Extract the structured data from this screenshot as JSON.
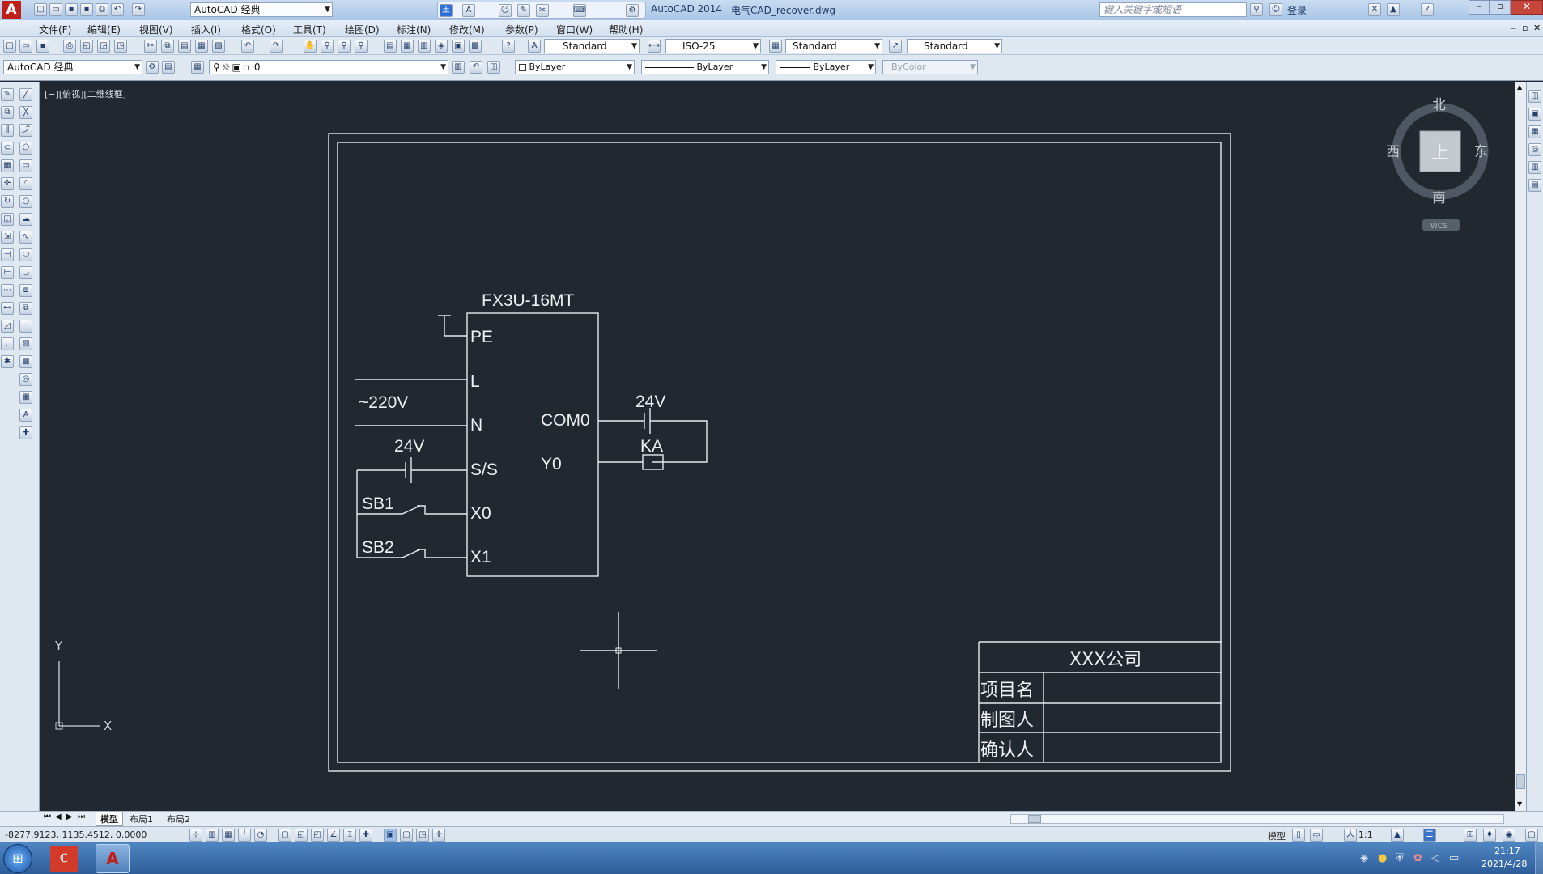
{
  "titlebar": {
    "workspace": "AutoCAD 经典",
    "app_name": "AutoCAD 2014",
    "file_name": "电气CAD_recover.dwg",
    "search_placeholder": "键入关键字或短语",
    "login": "登录"
  },
  "menu": [
    "文件(F)",
    "编辑(E)",
    "视图(V)",
    "插入(I)",
    "格式(O)",
    "工具(T)",
    "绘图(D)",
    "标注(N)",
    "修改(M)",
    "参数(P)",
    "窗口(W)",
    "帮助(H)"
  ],
  "styles": {
    "text_style": "Standard",
    "dim_style": "ISO-25",
    "table_style": "Standard",
    "mleader_style": "Standard"
  },
  "layers": {
    "workspace": "AutoCAD 经典",
    "current_layer": "0",
    "color": "ByLayer",
    "linetype": "ByLayer",
    "lineweight": "ByLayer",
    "plot_style": "ByColor"
  },
  "viewport_label": "[−][俯视][二维线框]",
  "viewcube": {
    "north": "北",
    "south": "南",
    "east": "东",
    "west": "西",
    "top": "上",
    "wcs": "WCS"
  },
  "ucs": {
    "x": "X",
    "y": "Y"
  },
  "drawing": {
    "plc_model": "FX3U-16MT",
    "left_terminals": [
      "PE",
      "L",
      "N",
      "S/S",
      "X0",
      "X1"
    ],
    "right_terminals": [
      "COM0",
      "Y0"
    ],
    "supply_label": "~220V",
    "dc_label_left": "24V",
    "dc_label_right": "24V",
    "relay_label": "KA",
    "switches": [
      "SB1",
      "SB2"
    ],
    "title_block": {
      "company": "XXX公司",
      "rows": [
        "项目名",
        "制图人",
        "确认人"
      ]
    }
  },
  "layout_tabs": [
    "模型",
    "布局1",
    "布局2"
  ],
  "status": {
    "coordinates": "-8277.9123, 1135.4512, 0.0000",
    "model": "模型",
    "scale": "1:1"
  },
  "clock": {
    "time": "21:17",
    "date": "2021/4/28"
  },
  "colors": {
    "canvas": "#212830",
    "lines": "#e8eaee",
    "ribbon": "#dfe7f1"
  }
}
